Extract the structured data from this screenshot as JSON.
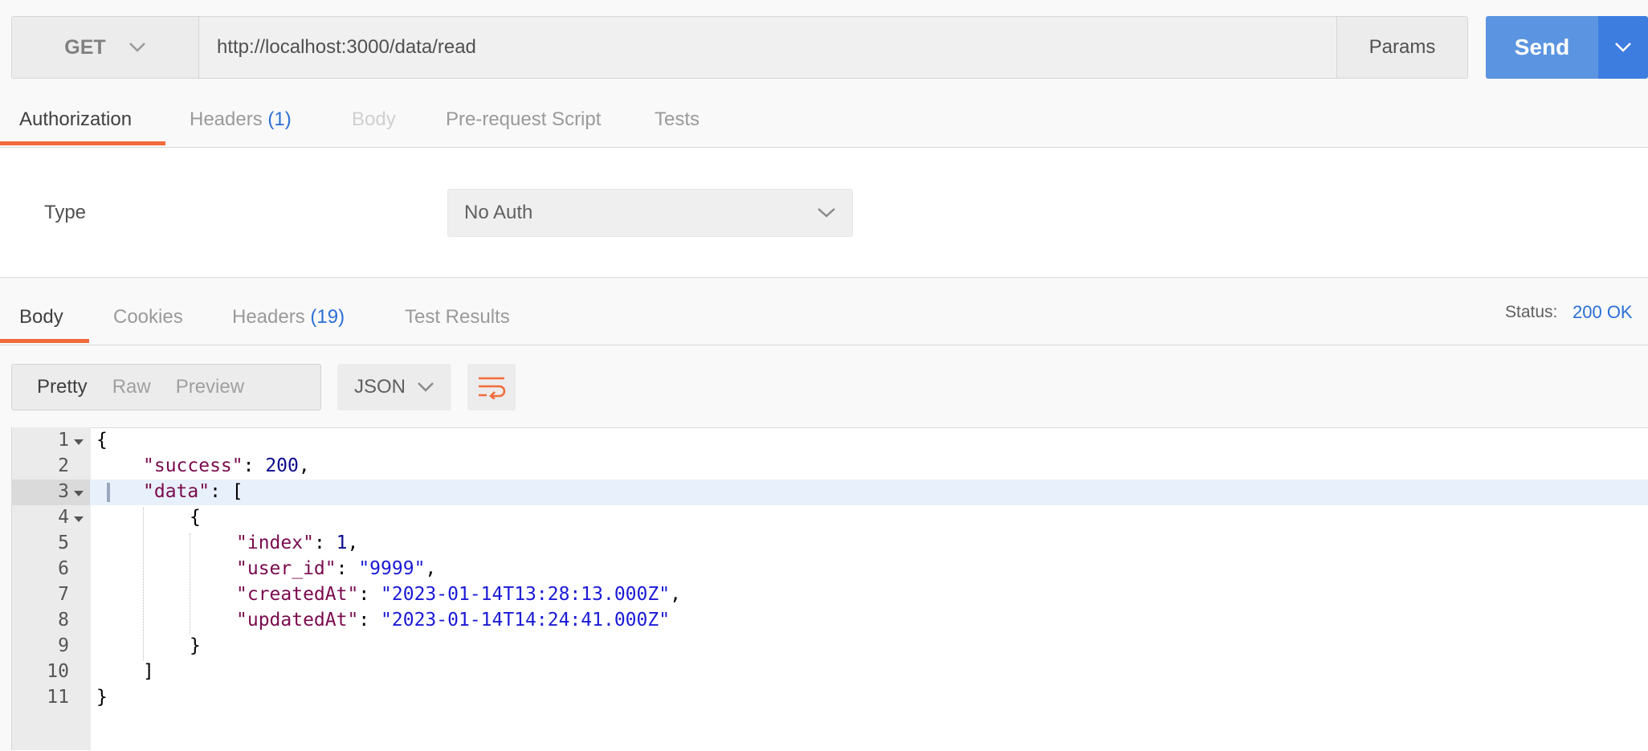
{
  "request": {
    "method": "GET",
    "url": "http://localhost:3000/data/read",
    "params_label": "Params",
    "send_label": "Send"
  },
  "request_tabs": [
    {
      "label": "Authorization"
    },
    {
      "label": "Headers ",
      "count": "(1)"
    },
    {
      "label": "Body"
    },
    {
      "label": "Pre-request Script"
    },
    {
      "label": "Tests"
    }
  ],
  "auth": {
    "type_label": "Type",
    "type_value": "No Auth"
  },
  "response_tabs": [
    {
      "label": "Body"
    },
    {
      "label": "Cookies"
    },
    {
      "label": "Headers ",
      "count": "(19)"
    },
    {
      "label": "Test Results"
    }
  ],
  "status": {
    "label": "Status:",
    "value": "200 OK"
  },
  "view_modes": [
    "Pretty",
    "Raw",
    "Preview"
  ],
  "format": "JSON",
  "line_numbers": [
    "1",
    "2",
    "3",
    "4",
    "5",
    "6",
    "7",
    "8",
    "9",
    "10",
    "11"
  ],
  "code": {
    "l1": "{",
    "success_key": "\"success\"",
    "success_val": "200",
    "data_key": "\"data\"",
    "data_open": "[",
    "obj_open": "{",
    "index_key": "\"index\"",
    "index_val": "1",
    "user_id_key": "\"user_id\"",
    "user_id_val": "\"9999\"",
    "created_key": "\"createdAt\"",
    "created_val": "\"2023-01-14T13:28:13.000Z\"",
    "updated_key": "\"updatedAt\"",
    "updated_val": "\"2023-01-14T14:24:41.000Z\"",
    "obj_close": "}",
    "data_close": "]",
    "l11": "}"
  },
  "colors": {
    "accent": "#f26b3a",
    "send": "#5b94e0",
    "link_blue": "#2a6fd6",
    "json_key": "#7a0a4e",
    "json_string": "#1a1ad6",
    "json_number": "#0a0a8c"
  },
  "icons": {
    "method_caret": "chevron-down-icon",
    "send_caret": "chevron-down-icon",
    "auth_caret": "chevron-down-icon",
    "format_caret": "chevron-down-icon",
    "wrap": "wrap-lines-icon"
  }
}
